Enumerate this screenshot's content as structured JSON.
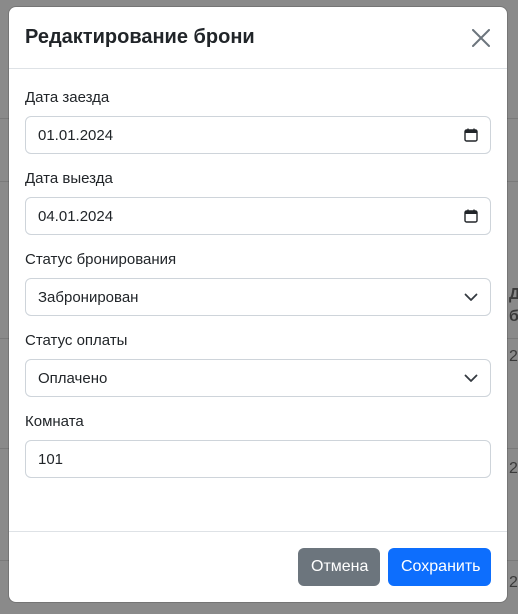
{
  "modal": {
    "title": "Редактирование брони",
    "fields": {
      "checkin": {
        "label": "Дата заезда",
        "value": "01.01.2024",
        "icon": "calendar-icon"
      },
      "checkout": {
        "label": "Дата выезда",
        "value": "04.01.2024",
        "icon": "calendar-icon"
      },
      "booking_status": {
        "label": "Статус бронирования",
        "value": "Забронирован",
        "icon": "chevron-down-icon"
      },
      "payment_status": {
        "label": "Статус оплаты",
        "value": "Оплачено",
        "icon": "chevron-down-icon"
      },
      "room": {
        "label": "Комната",
        "value": "101"
      }
    },
    "buttons": {
      "cancel": "Отмена",
      "save": "Сохранить"
    }
  },
  "background": {
    "fragments": [
      "Д",
      "б",
      "2",
      "2",
      "2"
    ]
  },
  "colors": {
    "primary": "#0d6efd",
    "secondary": "#6c757d",
    "backdrop": "#8a8a8a"
  }
}
